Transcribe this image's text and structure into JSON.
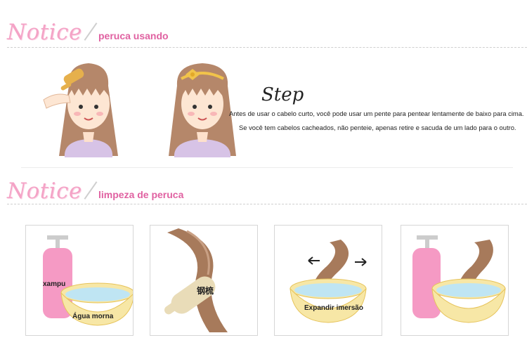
{
  "section1": {
    "notice_word": "Notice",
    "label": "peruca usando"
  },
  "section2": {
    "notice_word": "Notice",
    "label": "limpeza de peruca"
  },
  "step": {
    "title": "Step",
    "line1": "Antes de usar o cabelo curto, você pode usar um pente para pentear lentamente de baixo para cima.",
    "line2": "Se você tem cabelos cacheados, não penteie, apenas retire e sacuda de um lado para o outro."
  },
  "panels": {
    "panel1": {
      "bottle_label": "xampu",
      "bowl_label": "Água morna"
    },
    "panel2": {
      "comb_label": "钢梳"
    },
    "panel3": {
      "bowl_label": "Expandir imersão"
    }
  },
  "colors": {
    "accent_pink": "#e061a1",
    "notice_pink": "#f4a3c6",
    "hair_brown": "#a77a5b"
  }
}
